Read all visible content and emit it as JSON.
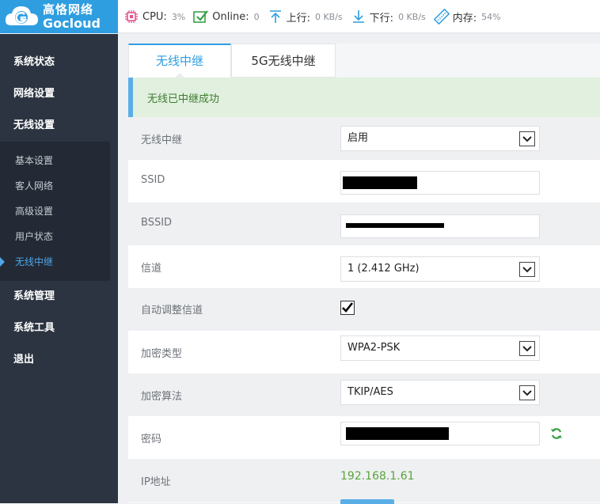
{
  "logo": {
    "cn": "高恪网络",
    "en": "Gocloud"
  },
  "stats": {
    "cpu_label": "CPU:",
    "cpu_value": "3%",
    "online_label": "Online:",
    "online_value": "0",
    "up_label": "上行:",
    "up_value": "0 KB/s",
    "down_label": "下行:",
    "down_value": "0 KB/s",
    "mem_label": "内存:",
    "mem_value": "54%"
  },
  "sidebar": {
    "top_items": [
      "系统状态",
      "网络设置",
      "无线设置"
    ],
    "sub_items": [
      "基本设置",
      "客人网络",
      "高级设置",
      "用户状态",
      "无线中继"
    ],
    "bottom_items": [
      "系统管理",
      "系统工具",
      "退出"
    ]
  },
  "tabs": {
    "tab1": "无线中继",
    "tab2": "5G无线中继"
  },
  "alert": "无线已中继成功",
  "form": {
    "relay_label": "无线中继",
    "relay_value": "启用",
    "ssid_label": "SSID",
    "bssid_label": "BSSID",
    "channel_label": "信道",
    "channel_value": "1 (2.412 GHz)",
    "auto_channel_label": "自动调整信道",
    "enc_type_label": "加密类型",
    "enc_type_value": "WPA2-PSK",
    "enc_alg_label": "加密算法",
    "enc_alg_value": "TKIP/AES",
    "password_label": "密码",
    "ip_label": "IP地址",
    "ip_value": "192.168.1.61"
  },
  "colors": {
    "accent": "#2f9ee0",
    "sidebar": "#2c3441",
    "success": "#59a43c"
  }
}
